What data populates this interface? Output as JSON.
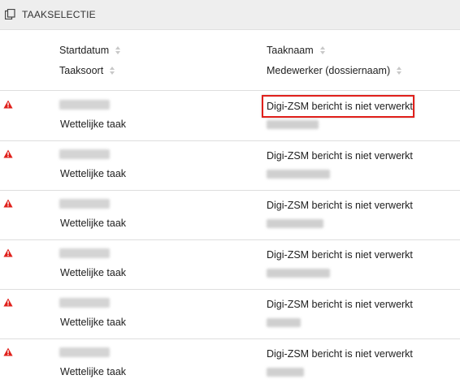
{
  "header": {
    "title": "TAAKSELECTIE",
    "icon": "copy-icon"
  },
  "columns": {
    "col1_top": "Startdatum",
    "col1_bottom": "Taaksoort",
    "col2_top": "Taaknaam",
    "col2_bottom": "Medewerker (dossiernaam)"
  },
  "colors": {
    "warning": "#e0201b",
    "highlight": "#e0201b"
  },
  "rows": [
    {
      "icon": "warning-icon",
      "taaksoort": "Wettelijke taak",
      "taaknaam": "Digi-ZSM bericht is niet verwerkt",
      "highlighted": true
    },
    {
      "icon": "warning-icon",
      "taaksoort": "Wettelijke taak",
      "taaknaam": "Digi-ZSM bericht is niet verwerkt"
    },
    {
      "icon": "warning-icon",
      "taaksoort": "Wettelijke taak",
      "taaknaam": "Digi-ZSM bericht is niet verwerkt"
    },
    {
      "icon": "warning-icon",
      "taaksoort": "Wettelijke taak",
      "taaknaam": "Digi-ZSM bericht is niet verwerkt"
    },
    {
      "icon": "warning-icon",
      "taaksoort": "Wettelijke taak",
      "taaknaam": "Digi-ZSM bericht is niet verwerkt"
    },
    {
      "icon": "warning-icon",
      "taaksoort": "Wettelijke taak",
      "taaknaam": "Digi-ZSM bericht is niet verwerkt"
    }
  ]
}
